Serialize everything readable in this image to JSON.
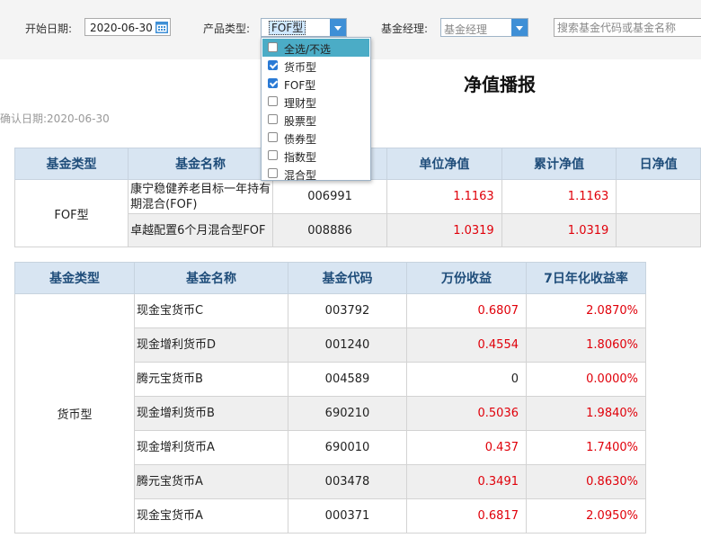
{
  "filters": {
    "start_date_label": "开始日期:",
    "start_date_value": "2020-06-30",
    "product_type_label": "产品类型:",
    "product_type_value": "FOF型",
    "manager_label": "基金经理:",
    "manager_value": "基金经理",
    "search_placeholder": "搜索基金代码或基金名称"
  },
  "dropdown": {
    "items": [
      {
        "label": "全选/不选",
        "checked": false
      },
      {
        "label": "货币型",
        "checked": true
      },
      {
        "label": "FOF型",
        "checked": true
      },
      {
        "label": "理财型",
        "checked": false
      },
      {
        "label": "股票型",
        "checked": false
      },
      {
        "label": "债券型",
        "checked": false
      },
      {
        "label": "指数型",
        "checked": false
      },
      {
        "label": "混合型",
        "checked": false
      }
    ]
  },
  "page": {
    "title": "净值播报",
    "confirm_date": "确认日期:2020-06-30"
  },
  "table1": {
    "headers": [
      "基金类型",
      "基金名称",
      "",
      "单位净值",
      "累计净值",
      "日净值"
    ],
    "group": "FOF型",
    "rows": [
      {
        "name": "康宁稳健养老目标一年持有期混合(FOF)",
        "code": "006991",
        "unit_nav": "1.1163",
        "acc_nav": "1.1163"
      },
      {
        "name": "卓越配置6个月混合型FOF",
        "code": "008886",
        "unit_nav": "1.0319",
        "acc_nav": "1.0319"
      }
    ]
  },
  "table2": {
    "headers": [
      "基金类型",
      "基金名称",
      "基金代码",
      "万份收益",
      "7日年化收益率"
    ],
    "group": "货币型",
    "rows": [
      {
        "name": "现金宝货币C",
        "code": "003792",
        "income": "0.6807",
        "yield7": "2.0870%"
      },
      {
        "name": "现金增利货币D",
        "code": "001240",
        "income": "0.4554",
        "yield7": "1.8060%"
      },
      {
        "name": "腾元宝货币B",
        "code": "004589",
        "income": "0",
        "yield7": "0.0000%"
      },
      {
        "name": "现金增利货币B",
        "code": "690210",
        "income": "0.5036",
        "yield7": "1.9840%"
      },
      {
        "name": "现金增利货币A",
        "code": "690010",
        "income": "0.437",
        "yield7": "1.7400%"
      },
      {
        "name": "腾元宝货币A",
        "code": "003478",
        "income": "0.3491",
        "yield7": "0.8630%"
      },
      {
        "name": "现金宝货币A",
        "code": "000371",
        "income": "0.6817",
        "yield7": "2.0950%"
      }
    ]
  },
  "colors": {
    "accent": "#3e8fd6",
    "header_bg": "#d8e5f2",
    "header_text": "#1f4d7a",
    "highlight": "#4bacc6",
    "value_red": "#e0000a"
  }
}
